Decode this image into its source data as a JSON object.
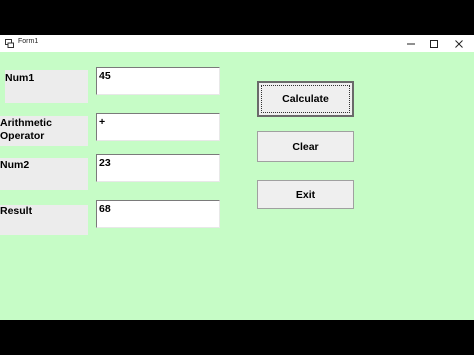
{
  "window": {
    "title": "Form1"
  },
  "form": {
    "num1_label": "Num1",
    "operator_label_line1": "Arithmetic",
    "operator_label_line2": "Operator",
    "num2_label": "Num2",
    "result_label": "Result",
    "num1_value": "45",
    "operator_value": "+",
    "num2_value": "23",
    "result_value": "68"
  },
  "buttons": {
    "calculate": "Calculate",
    "clear": "Clear",
    "exit": "Exit"
  },
  "colors": {
    "form_background": "#c6fcc6"
  }
}
